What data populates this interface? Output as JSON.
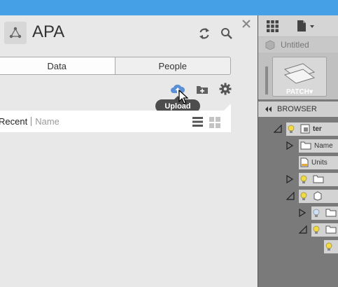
{
  "data_panel": {
    "project_title": "APA",
    "tabs": [
      {
        "label": "Data"
      },
      {
        "label": "People"
      }
    ],
    "tooltip": "Upload",
    "filter": {
      "sort_recent": "Recent",
      "sort_name": "Name"
    }
  },
  "fusion": {
    "document_tab": "Untitled",
    "ribbon_button": "PATCH▾",
    "browser_label": "BROWSER",
    "tree_items": [
      {
        "label": "ter"
      },
      {
        "label": "Name"
      },
      {
        "label": "Units"
      }
    ]
  },
  "colors": {
    "accent_bar": "#45a0e6",
    "upload_icon": "#5b8fd6"
  }
}
